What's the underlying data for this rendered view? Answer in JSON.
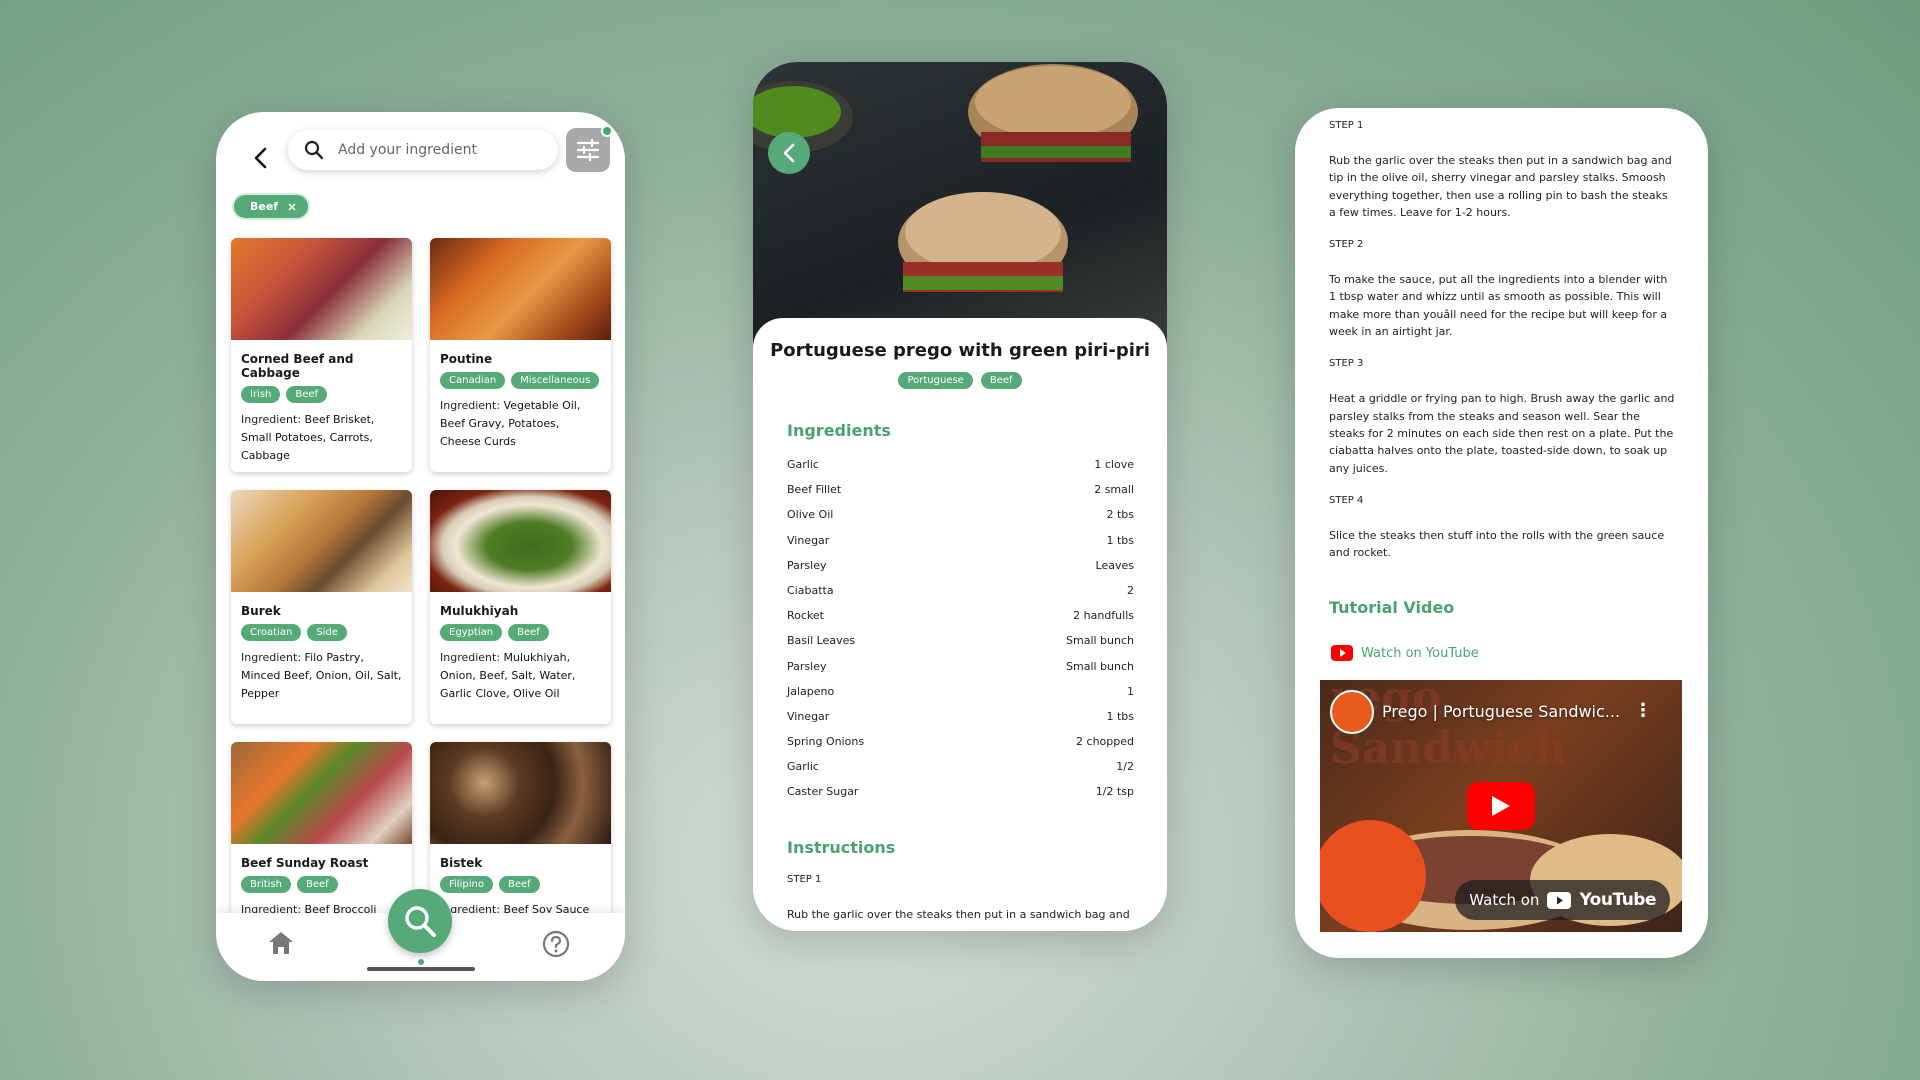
{
  "colors": {
    "accent": "#55aa78",
    "heading_green": "#4aa36f",
    "youtube_red": "#ff0000"
  },
  "search": {
    "placeholder": "Add your ingredient"
  },
  "active_filter": {
    "label": "Beef"
  },
  "recipes": [
    {
      "title": "Corned Beef and Cabbage",
      "tags": [
        "Irish",
        "Beef"
      ],
      "ingredient_label": "Ingredient: ",
      "ingredients": "Beef Brisket, Small Potatoes, Carrots, Cabbage"
    },
    {
      "title": "Poutine",
      "tags": [
        "Canadian",
        "Miscellaneous"
      ],
      "ingredient_label": "Ingredient: ",
      "ingredients": "Vegetable Oil, Beef Gravy, Potatoes, Cheese Curds"
    },
    {
      "title": "Burek",
      "tags": [
        "Croatian",
        "Side"
      ],
      "ingredient_label": "Ingredient: ",
      "ingredients": "Filo Pastry, Minced Beef, Onion, Oil, Salt, Pepper"
    },
    {
      "title": "Mulukhiyah",
      "tags": [
        "Egyptian",
        "Beef"
      ],
      "ingredient_label": "Ingredient: ",
      "ingredients": "Mulukhiyah, Onion, Beef, Salt, Water, Garlic Clove, Olive Oil"
    },
    {
      "title": "Beef Sunday Roast",
      "tags": [
        "British",
        "Beef"
      ],
      "ingredient_label": "Ingredient: ",
      "ingredients": "Beef Broccoli"
    },
    {
      "title": "Bistek",
      "tags": [
        "Filipino",
        "Beef"
      ],
      "ingredient_label": "Ingredient: ",
      "ingredients": "Beef Soy Sauce"
    }
  ],
  "detail": {
    "title": "Portuguese prego with green piri-piri",
    "tags": [
      "Portuguese",
      "Beef"
    ],
    "ingredients_heading": "Ingredients",
    "ingredients": [
      {
        "name": "Garlic",
        "qty": "1 clove"
      },
      {
        "name": "Beef Fillet",
        "qty": "2 small"
      },
      {
        "name": "Olive Oil",
        "qty": "2 tbs"
      },
      {
        "name": "Vinegar",
        "qty": "1 tbs"
      },
      {
        "name": "Parsley",
        "qty": "Leaves"
      },
      {
        "name": "Ciabatta",
        "qty": "2"
      },
      {
        "name": "Rocket",
        "qty": "2 handfulls"
      },
      {
        "name": "Basil Leaves",
        "qty": "Small bunch"
      },
      {
        "name": "Parsley",
        "qty": "Small bunch"
      },
      {
        "name": "Jalapeno",
        "qty": "1"
      },
      {
        "name": "Vinegar",
        "qty": "1 tbs"
      },
      {
        "name": "Spring Onions",
        "qty": "2 chopped"
      },
      {
        "name": "Garlic",
        "qty": "1/2"
      },
      {
        "name": "Caster Sugar",
        "qty": "1/2 tsp"
      }
    ],
    "instructions_heading": "Instructions",
    "first_step_label": "STEP 1",
    "first_step_preview": "Rub the garlic over the steaks then put in a sandwich bag and"
  },
  "instructions": [
    {
      "label": "STEP 1",
      "text": "Rub the garlic over the steaks then put in a sandwich bag and tip in the olive oil, sherry vinegar and parsley stalks. Smoosh everything together, then use a rolling pin to bash the steaks a few times. Leave for 1-2 hours."
    },
    {
      "label": "STEP 2",
      "text": "To make the sauce, put all the ingredients into a blender with 1 tbsp water and whizz until as smooth as possible. This will make more than youâll need for the recipe but will keep for a week in an airtight jar."
    },
    {
      "label": "STEP 3",
      "text": "Heat a griddle or frying pan to high. Brush away the garlic and parsley stalks from the steaks and season well. Sear the steaks for 2 minutes on each side then rest on a plate. Put the ciabatta halves onto the plate, toasted-side down, to soak up any juices."
    },
    {
      "label": "STEP 4",
      "text": "Slice the steaks then stuff into the rolls with the green sauce and rocket."
    }
  ],
  "tutorial": {
    "heading": "Tutorial Video",
    "link_label": "Watch on YouTube",
    "video_title": "Prego | Portuguese Sandwic...",
    "video_bg_text": "rego Sandwich",
    "watch_on": "Watch on",
    "youtube_word": "YouTube"
  },
  "icons": {
    "back": "chevron-left-icon",
    "search": "search-icon",
    "filter": "sliders-icon",
    "home": "home-icon",
    "help": "help-circle-icon",
    "play": "play-icon",
    "youtube": "youtube-icon"
  }
}
